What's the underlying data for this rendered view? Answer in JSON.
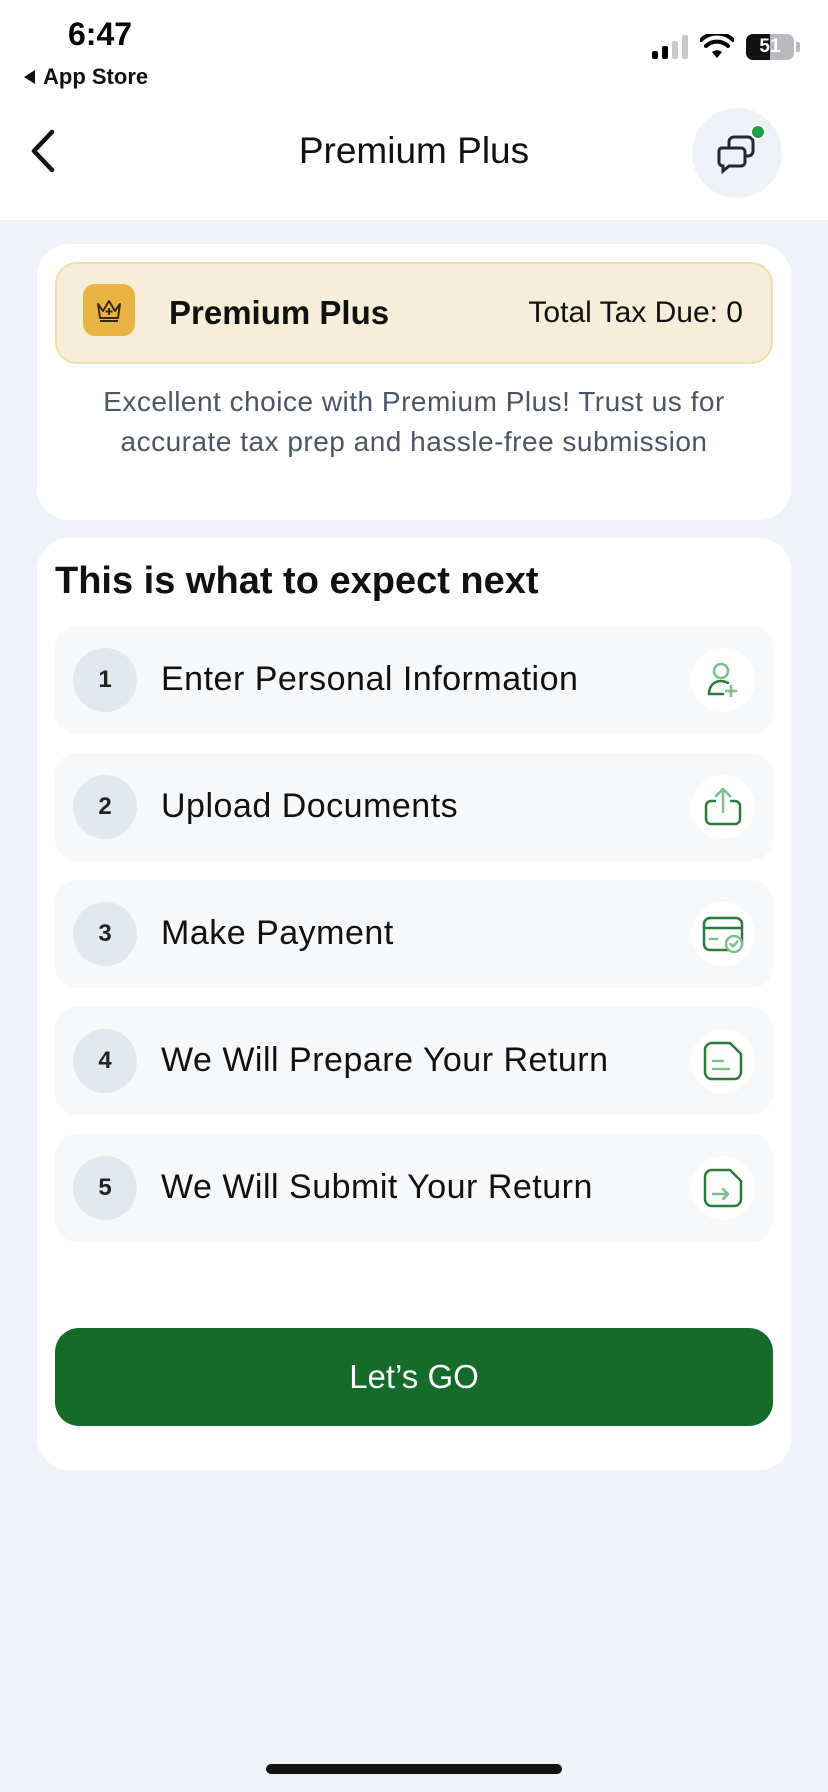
{
  "status_bar": {
    "time": "6:47",
    "back_app": "App Store",
    "battery": "51"
  },
  "header": {
    "title": "Premium Plus"
  },
  "plan": {
    "name": "Premium Plus",
    "tax_due": "Total Tax Due: 0",
    "description": "Excellent choice with Premium Plus! Trust us for accurate tax prep and hassle-free submission"
  },
  "steps_section": {
    "title": "This is what to expect next",
    "steps": [
      {
        "number": "1",
        "label": "Enter Personal Information",
        "icon": "add-user-icon"
      },
      {
        "number": "2",
        "label": "Upload Documents",
        "icon": "upload-icon"
      },
      {
        "number": "3",
        "label": "Make Payment",
        "icon": "card-check-icon"
      },
      {
        "number": "4",
        "label": "We Will Prepare Your Return",
        "icon": "document-lines-icon"
      },
      {
        "number": "5",
        "label": "We Will Submit Your Return",
        "icon": "document-arrow-icon"
      }
    ]
  },
  "cta": {
    "label": "Let’s GO"
  },
  "colors": {
    "brand_green": "#166b2b",
    "plan_bg": "#f6eed8",
    "crown_gold": "#e8b545",
    "notification_dot": "#1fa14a"
  }
}
